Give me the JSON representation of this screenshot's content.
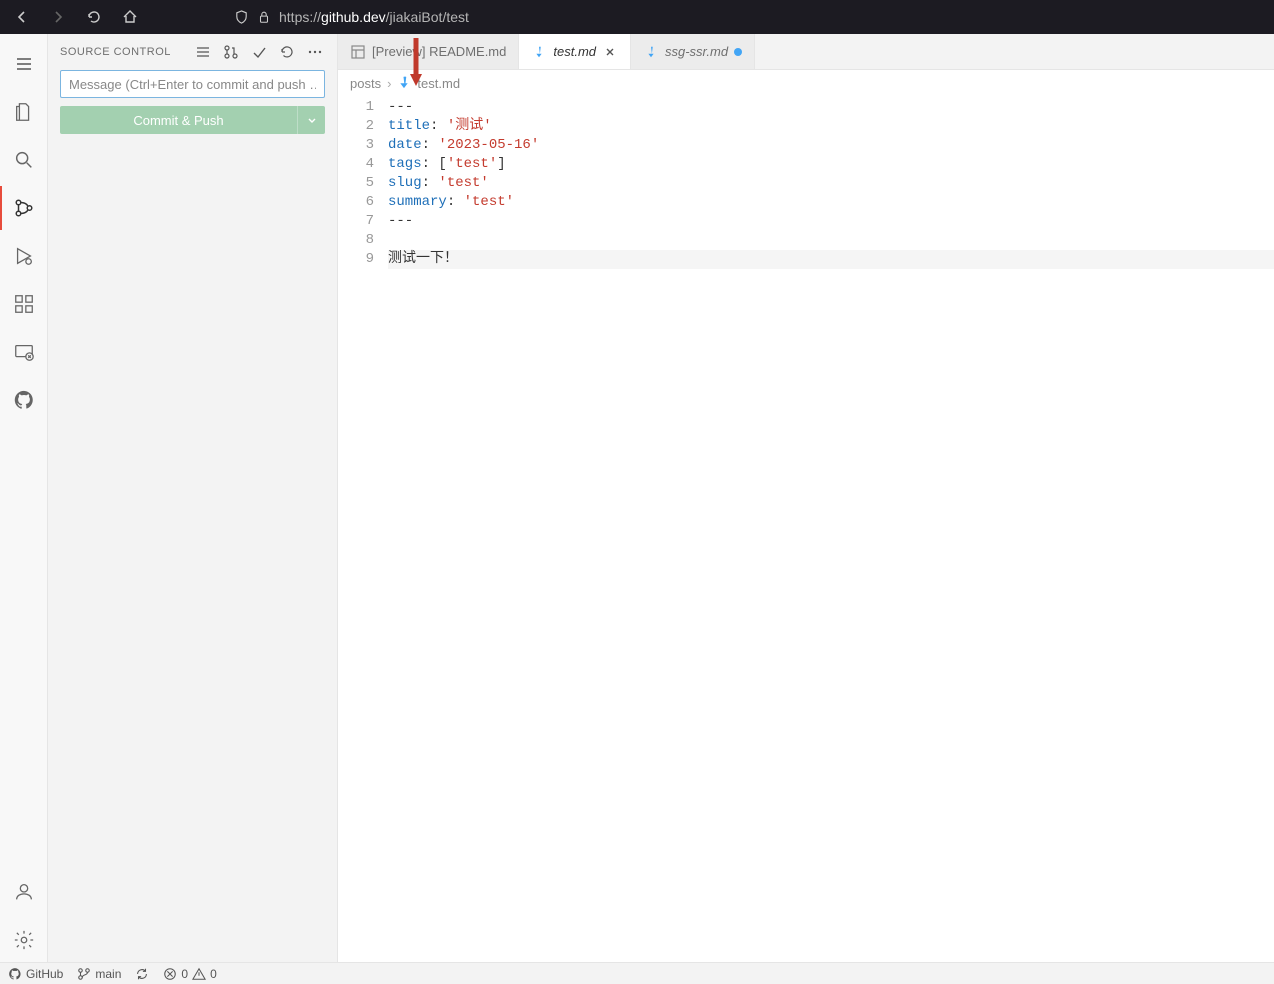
{
  "browser": {
    "url_prefix": "https://",
    "url_domain": "github.dev",
    "url_path": "/jiakaiBot/test"
  },
  "sidebar": {
    "title": "SOURCE CONTROL",
    "commit_placeholder": "Message (Ctrl+Enter to commit and push …",
    "commit_button": "Commit & Push"
  },
  "tabs": [
    {
      "label": "[Preview] README.md",
      "icon": "preview",
      "active": false,
      "modified": false
    },
    {
      "label": "test.md",
      "icon": "md",
      "active": true,
      "modified": true,
      "closable": true
    },
    {
      "label": "ssg-ssr.md",
      "icon": "md",
      "active": false,
      "modified": true
    }
  ],
  "breadcrumb": {
    "folder": "posts",
    "file": "test.md"
  },
  "editor": {
    "lines": [
      {
        "n": 1,
        "tokens": [
          {
            "t": "---",
            "c": "p"
          }
        ]
      },
      {
        "n": 2,
        "tokens": [
          {
            "t": "title",
            "c": "k"
          },
          {
            "t": ": ",
            "c": "p"
          },
          {
            "t": "'测试'",
            "c": "s"
          }
        ]
      },
      {
        "n": 3,
        "tokens": [
          {
            "t": "date",
            "c": "k"
          },
          {
            "t": ": ",
            "c": "p"
          },
          {
            "t": "'2023-05-16'",
            "c": "s"
          }
        ]
      },
      {
        "n": 4,
        "tokens": [
          {
            "t": "tags",
            "c": "k"
          },
          {
            "t": ": [",
            "c": "p"
          },
          {
            "t": "'test'",
            "c": "s"
          },
          {
            "t": "]",
            "c": "p"
          }
        ]
      },
      {
        "n": 5,
        "tokens": [
          {
            "t": "slug",
            "c": "k"
          },
          {
            "t": ": ",
            "c": "p"
          },
          {
            "t": "'test'",
            "c": "s"
          }
        ]
      },
      {
        "n": 6,
        "tokens": [
          {
            "t": "summary",
            "c": "k"
          },
          {
            "t": ": ",
            "c": "p"
          },
          {
            "t": "'test'",
            "c": "s"
          }
        ]
      },
      {
        "n": 7,
        "tokens": [
          {
            "t": "---",
            "c": "p"
          }
        ]
      },
      {
        "n": 8,
        "tokens": [
          {
            "t": "",
            "c": "p"
          }
        ]
      },
      {
        "n": 9,
        "tokens": [
          {
            "t": "测试一下！",
            "c": "p"
          }
        ],
        "current": true
      }
    ]
  },
  "statusbar": {
    "github": "GitHub",
    "branch": "main",
    "errors": "0",
    "warnings": "0"
  }
}
